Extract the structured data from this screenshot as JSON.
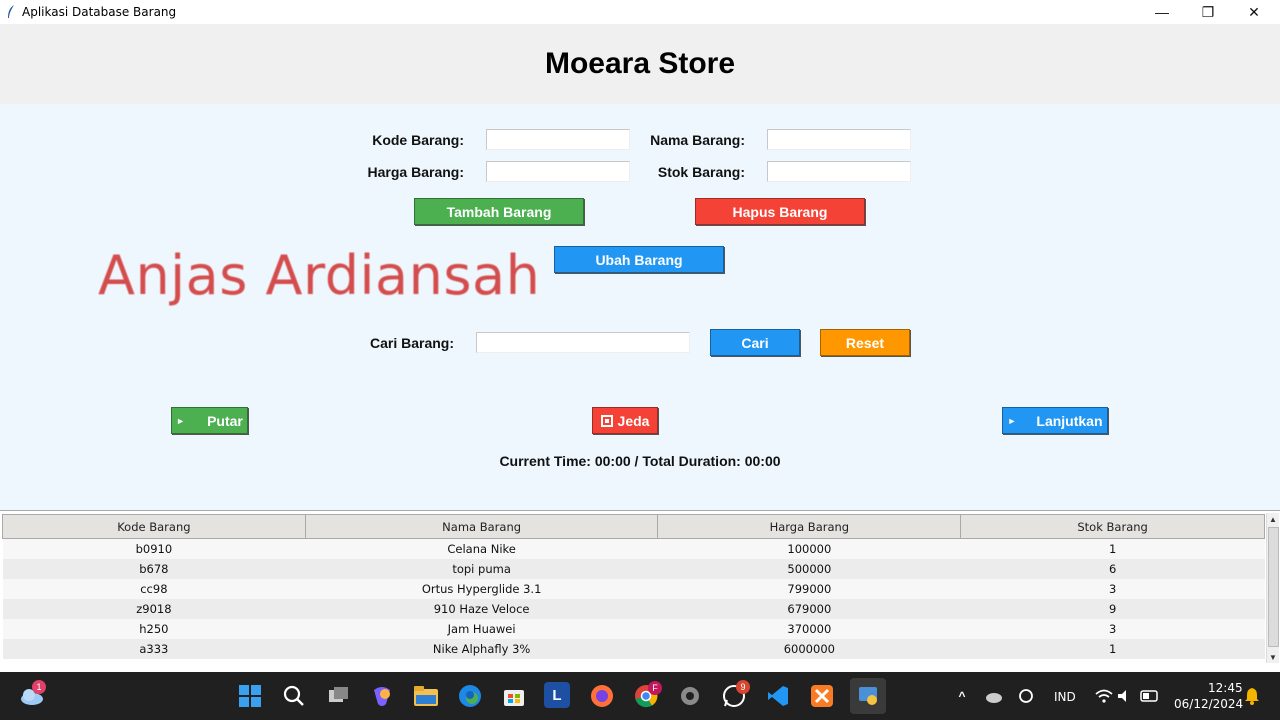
{
  "window": {
    "title": "Aplikasi Database Barang",
    "minimize": "—",
    "maximize": "❐",
    "close": "✕"
  },
  "header": {
    "title": "Moeara Store"
  },
  "form": {
    "kode_label": "Kode Barang:",
    "nama_label": "Nama Barang:",
    "harga_label": "Harga Barang:",
    "stok_label": "Stok Barang:",
    "kode_value": "",
    "nama_value": "",
    "harga_value": "",
    "stok_value": ""
  },
  "buttons": {
    "tambah": "Tambah Barang",
    "hapus": "Hapus Barang",
    "ubah": "Ubah Barang",
    "cari": "Cari",
    "reset": "Reset"
  },
  "search": {
    "label": "Cari Barang:",
    "value": ""
  },
  "watermark": "Anjas Ardiansah",
  "media": {
    "putar": "Putar",
    "jeda": "Jeda",
    "lanjutkan": "Lanjutkan",
    "time_text": "Current Time: 00:00 / Total Duration: 00:00"
  },
  "table": {
    "headers": [
      "Kode Barang",
      "Nama Barang",
      "Harga Barang",
      "Stok Barang"
    ],
    "rows": [
      [
        "b0910",
        "Celana Nike",
        "100000",
        "1"
      ],
      [
        "b678",
        "topi puma",
        "500000",
        "6"
      ],
      [
        "cc98",
        "Ortus Hyperglide 3.1",
        "799000",
        "3"
      ],
      [
        "z9018",
        "910 Haze Veloce",
        "679000",
        "9"
      ],
      [
        "h250",
        "Jam Huawei",
        "370000",
        "3"
      ],
      [
        "a333",
        "Nike Alphafly 3%",
        "6000000",
        "1"
      ]
    ]
  },
  "taskbar": {
    "weather_badge": "1",
    "whatsapp_badge": "9",
    "firefox_badge": "F",
    "language": "IND",
    "time": "12:45",
    "date": "06/12/2024",
    "launcher_letter": "L"
  },
  "colors": {
    "tambah": "#4caf50",
    "hapus": "#f44336",
    "ubah": "#2196f3",
    "cari": "#2196f3",
    "reset": "#ff9800",
    "putar": "#4caf50",
    "jeda": "#f44336",
    "lanjutkan": "#2196f3"
  }
}
